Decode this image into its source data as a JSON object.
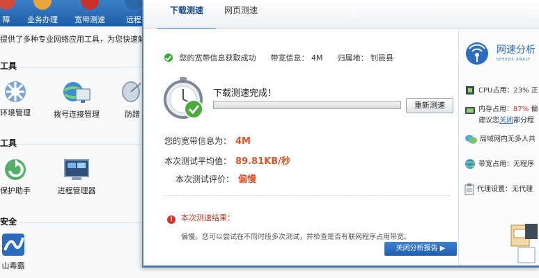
{
  "background_app": {
    "top_items": [
      "障",
      "业务办理",
      "宽带测速",
      "远程"
    ],
    "description": "提供了多种专业网络应用工具，为您快速解",
    "sections": [
      {
        "title": "工具",
        "tools": [
          "环境管理",
          "拨号连接管理",
          "防蹭"
        ]
      },
      {
        "title": "工具",
        "tools": [
          "保护助手",
          "进程管理器"
        ]
      },
      {
        "title": "安全",
        "tools": [
          "山毒霸"
        ]
      }
    ]
  },
  "speed_window": {
    "tabs": [
      {
        "label": "下载测速",
        "active": true
      },
      {
        "label": "网页测速",
        "active": false
      }
    ],
    "status": {
      "success_text": "您的宽带信息获取成功",
      "bandwidth_label": "带宽信息：",
      "bandwidth_value": "4M",
      "location_label": "归属地：",
      "location_value": "钊邑县"
    },
    "test": {
      "done_title": "下载测速完成！",
      "progress": 1.0,
      "retest_label": "重新测速"
    },
    "results": [
      {
        "label": "您的宽带信息为：",
        "value": "4M"
      },
      {
        "label": "本次测试平均值：",
        "value": "89.81KB/秒"
      },
      {
        "label": "本次测试评价：",
        "value": "偏慢"
      }
    ],
    "analysis": {
      "title": "本次测速结果：",
      "text": "偏慢。您可以尝试在不同时段多次测试，并检查是否有联网程序占用带宽。",
      "report_button": "关闭分析报告 ▶"
    }
  },
  "side_panel": {
    "title": "网速分析",
    "subtitle": "SPEEDS ANALY",
    "cpu": {
      "label": "CPU占用：",
      "value": "23%",
      "tail": "正"
    },
    "memory": {
      "label": "内存占用：",
      "value": "87%",
      "tail": "偏",
      "line2_pre": "建议您",
      "link": "关闭",
      "line2_post": "部分程"
    },
    "lan": {
      "text": "局域网内无多人共"
    },
    "bandwidth": {
      "label": "带宽占用：",
      "value": "无程序"
    },
    "proxy": {
      "label": "代理设置：",
      "value": "无代理"
    }
  },
  "colors": {
    "accent_blue": "#2d6cc0",
    "result_orange": "#d8572a",
    "warning_red": "#d6332b",
    "success_green": "#3aa93a"
  }
}
